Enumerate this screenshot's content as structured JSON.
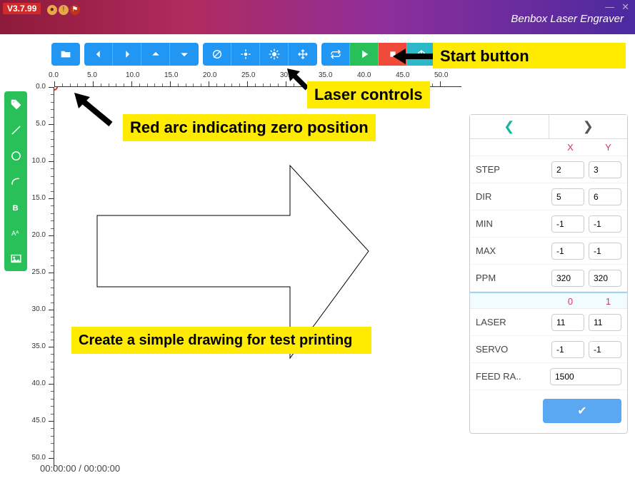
{
  "app": {
    "version": "V3.7.99",
    "title": "Benbox Laser Engraver"
  },
  "status": {
    "time": "00:00:00 / 00:00:00"
  },
  "ruler": {
    "h_labels": [
      "0.0",
      "5.0",
      "10.0",
      "15.0",
      "20.0",
      "25.0",
      "30.0",
      "35.0",
      "40.0",
      "45.0",
      "50.0"
    ],
    "v_labels": [
      "0.0",
      "5.0",
      "10.0",
      "15.0",
      "20.0",
      "25.0",
      "30.0",
      "35.0",
      "40.0",
      "45.0",
      "50.0"
    ]
  },
  "panel": {
    "head1": {
      "colA": "X",
      "colB": "Y"
    },
    "rows1": [
      {
        "label": "STEP",
        "a": "2",
        "b": "3"
      },
      {
        "label": "DIR",
        "a": "5",
        "b": "6"
      },
      {
        "label": "MIN",
        "a": "-1",
        "b": "-1"
      },
      {
        "label": "MAX",
        "a": "-1",
        "b": "-1"
      },
      {
        "label": "PPM",
        "a": "320",
        "b": "320"
      }
    ],
    "head2": {
      "colA": "0",
      "colB": "1"
    },
    "rows2": [
      {
        "label": "LASER",
        "a": "11",
        "b": "11"
      },
      {
        "label": "SERVO",
        "a": "-1",
        "b": "-1"
      }
    ],
    "feed": {
      "label": "FEED RA..",
      "value": "1500"
    }
  },
  "annotations": {
    "start": "Start button",
    "laser_controls": "Laser controls",
    "zero": "Red arc indicating zero position",
    "drawing": "Create a simple drawing for test printing"
  }
}
